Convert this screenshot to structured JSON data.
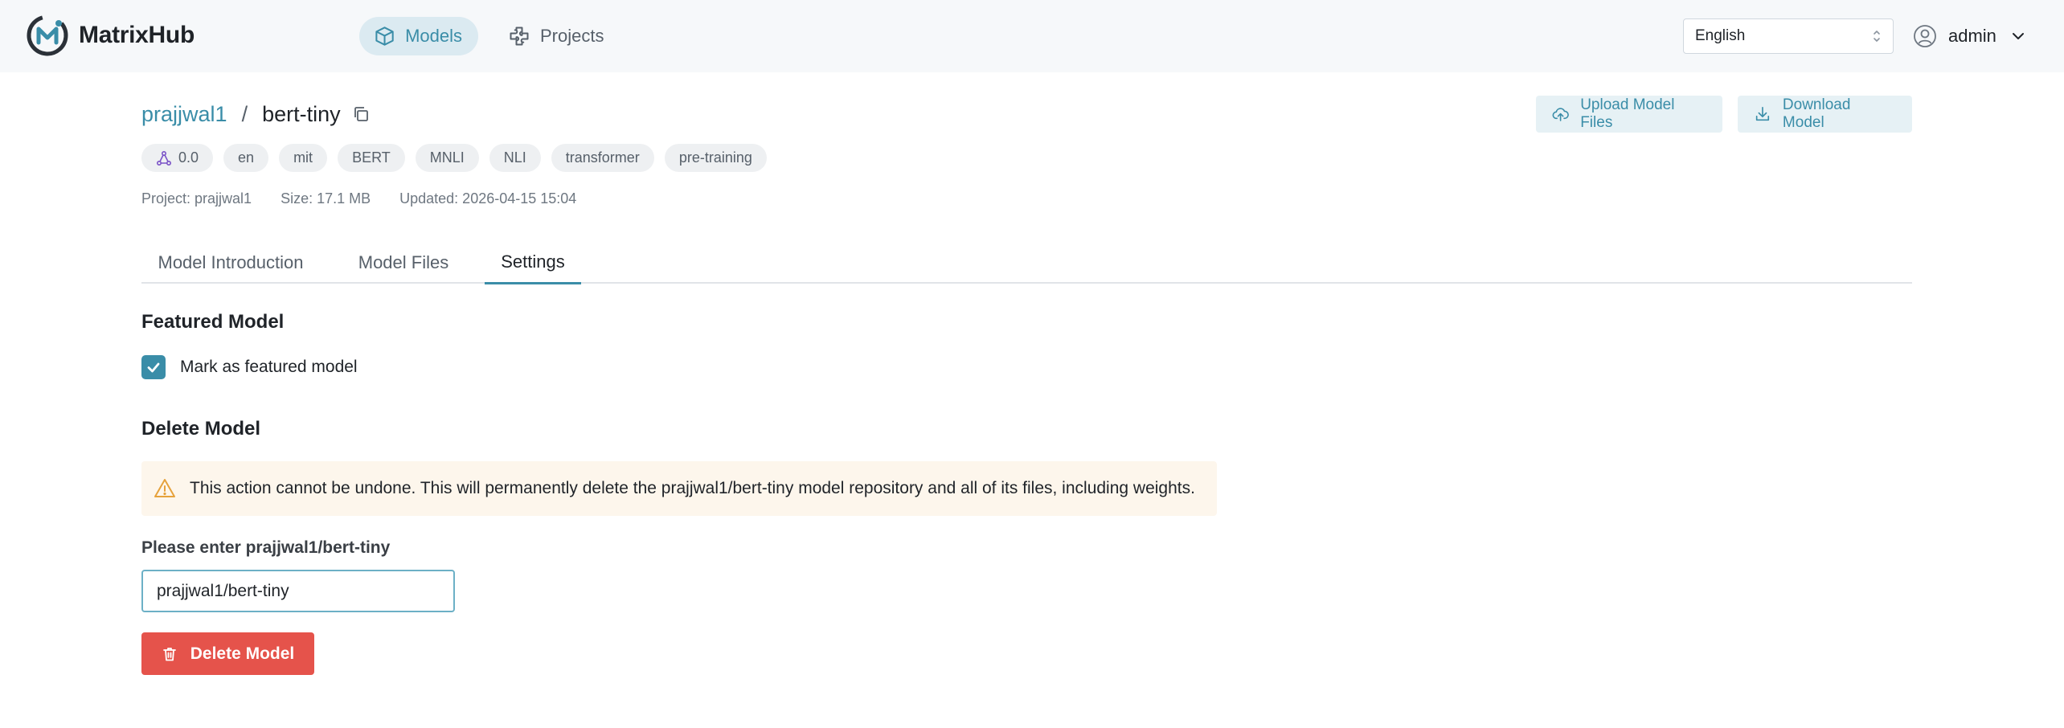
{
  "app": {
    "name": "MatrixHub"
  },
  "nav": [
    {
      "label": "Models",
      "active": true
    },
    {
      "label": "Projects",
      "active": false
    }
  ],
  "header": {
    "language": "English",
    "user": "admin"
  },
  "model": {
    "owner": "prajjwal1",
    "separator": "/",
    "name": "bert-tiny"
  },
  "actions": {
    "upload": "Upload Model Files",
    "download": "Download Model"
  },
  "tags": {
    "score": "0.0",
    "items": [
      "en",
      "mit",
      "BERT",
      "MNLI",
      "NLI",
      "transformer",
      "pre-training"
    ]
  },
  "meta": {
    "project": "Project: prajjwal1",
    "size": "Size: 17.1 MB",
    "updated": "Updated: 2026-04-15 15:04"
  },
  "tabs": [
    {
      "label": "Model Introduction",
      "active": false
    },
    {
      "label": "Model Files",
      "active": false
    },
    {
      "label": "Settings",
      "active": true
    }
  ],
  "settings": {
    "featured": {
      "title": "Featured Model",
      "checkbox_label": "Mark as featured model",
      "checked": true
    },
    "delete": {
      "title": "Delete Model",
      "warning": "This action cannot be undone. This will permanently delete the prajjwal1/bert-tiny model repository and all of its files, including weights.",
      "input_label": "Please enter prajjwal1/bert-tiny",
      "input_value": "prajjwal1/bert-tiny",
      "button": "Delete Model"
    }
  },
  "colors": {
    "accent": "#3a8da8",
    "danger": "#e5534b",
    "warning_bg": "#fdf6ec",
    "warning_icon": "#e6a23c"
  },
  "icons": {
    "logo": "matrixhub-logo-icon",
    "models": "cube-icon",
    "projects": "puzzle-icon",
    "user": "user-circle-icon",
    "copy": "copy-icon",
    "upload": "cloud-upload-icon",
    "download": "download-icon",
    "score": "graph-nodes-icon",
    "warning": "warning-triangle-icon",
    "delete": "trash-icon"
  }
}
